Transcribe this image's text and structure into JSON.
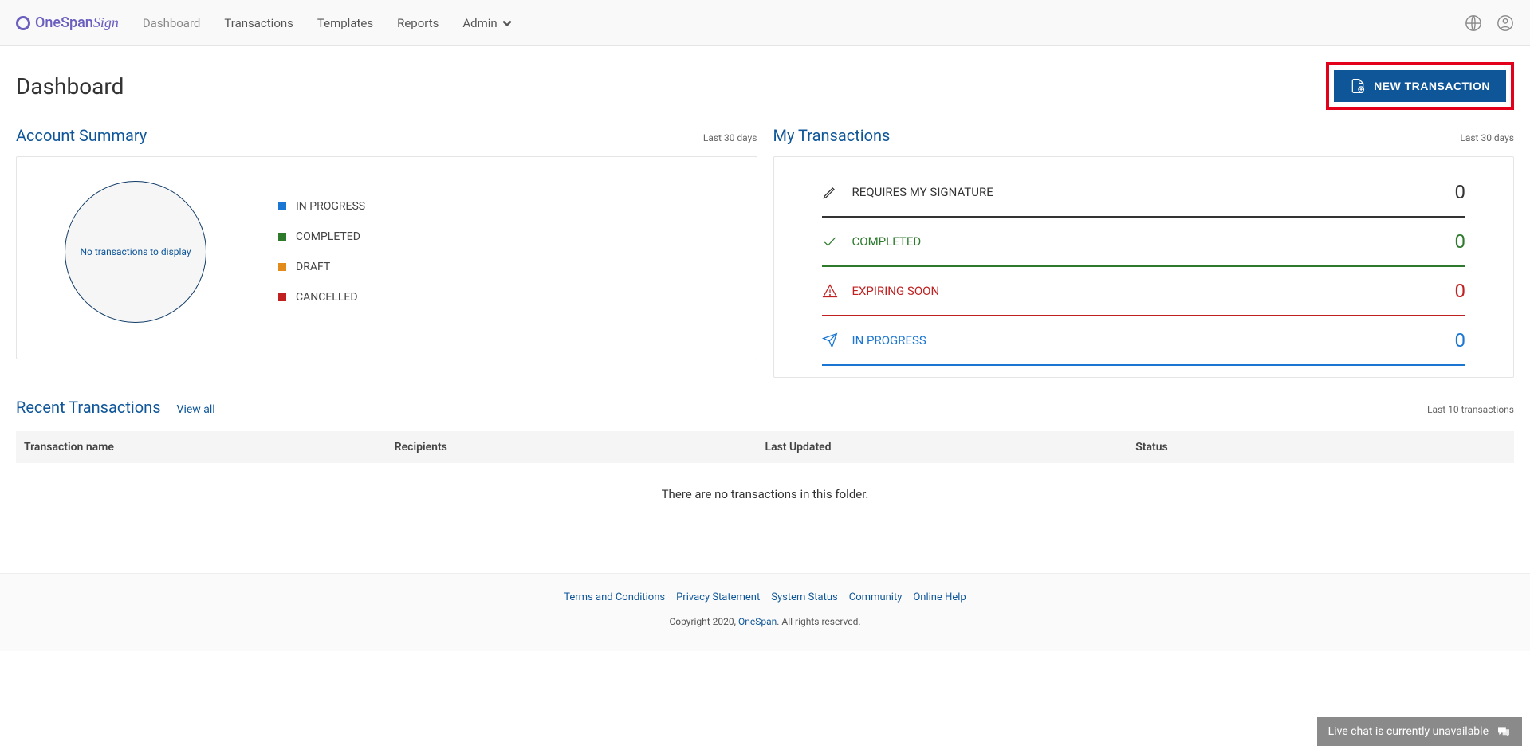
{
  "logo": {
    "brand": "OneSpan",
    "suffix": "Sign"
  },
  "nav": {
    "dashboard": "Dashboard",
    "transactions": "Transactions",
    "templates": "Templates",
    "reports": "Reports",
    "admin": "Admin"
  },
  "page": {
    "title": "Dashboard",
    "new_transaction": "NEW TRANSACTION"
  },
  "account_summary": {
    "title": "Account Summary",
    "range": "Last 30 days",
    "donut_empty": "No transactions to display",
    "legend": {
      "in_progress": {
        "label": "IN PROGRESS",
        "color": "#1a76d2"
      },
      "completed": {
        "label": "COMPLETED",
        "color": "#2d7a2d"
      },
      "draft": {
        "label": "DRAFT",
        "color": "#e38b1a"
      },
      "cancelled": {
        "label": "CANCELLED",
        "color": "#c02020"
      }
    }
  },
  "my_transactions": {
    "title": "My Transactions",
    "range": "Last 30 days",
    "rows": {
      "requires_sig": {
        "label": "REQUIRES MY SIGNATURE",
        "count": "0"
      },
      "completed": {
        "label": "COMPLETED",
        "count": "0"
      },
      "expiring": {
        "label": "EXPIRING SOON",
        "count": "0"
      },
      "in_progress": {
        "label": "IN PROGRESS",
        "count": "0"
      }
    }
  },
  "recent": {
    "title": "Recent Transactions",
    "view_all": "View all",
    "sub": "Last 10 transactions",
    "columns": {
      "name": "Transaction name",
      "recipients": "Recipients",
      "updated": "Last Updated",
      "status": "Status"
    },
    "empty": "There are no transactions in this folder."
  },
  "footer": {
    "links": {
      "terms": "Terms and Conditions",
      "privacy": "Privacy Statement",
      "status": "System Status",
      "community": "Community",
      "help": "Online Help"
    },
    "copyright_pre": "Copyright 2020, ",
    "copyright_link": "OneSpan",
    "copyright_post": ". All rights reserved."
  },
  "chat": {
    "text": "Live chat is currently unavailable"
  }
}
